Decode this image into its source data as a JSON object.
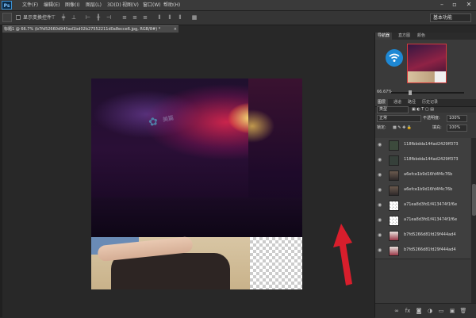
{
  "app": {
    "logo": "Ps"
  },
  "menubar": {
    "items": [
      "文件(F)",
      "编辑(E)",
      "图像(I)",
      "图层(L)",
      "3D(D)",
      "视图(V)",
      "窗口(W)",
      "帮助(H)"
    ]
  },
  "window_controls": {
    "minimize": "–",
    "restore": "▫",
    "close": "✕"
  },
  "options_bar": {
    "show_transform_label": "显示变换控件",
    "workspace": "基本功能"
  },
  "document": {
    "tab_title": "标题1 @ 66.7% (b7fd52660d940ad1bd02b27552211d0a8ecce6.jpg, RGB/8#) *",
    "close": "×",
    "watermark_text": "美篇"
  },
  "navigator": {
    "tabs": [
      "导航器",
      "直方图",
      "颜色"
    ],
    "zoom": "66.67%",
    "zoom_level": 0.25
  },
  "layers_panel": {
    "tabs": [
      "图层",
      "通道",
      "路径",
      "历史记录"
    ],
    "filter_kind": "类型",
    "blend_mode": "正常",
    "opacity_label": "不透明度:",
    "opacity_value": "100%",
    "lock_label": "锁定:",
    "fill_label": "填充:",
    "fill_value": "100%",
    "layers": [
      {
        "name": "118fbbdda144ad2429ff373",
        "thumb": "dark-photo"
      },
      {
        "name": "118fbbdda144ad2429ff373",
        "thumb": "dark-photo"
      },
      {
        "name": "a6efce1b9d16fd4f4c76b",
        "thumb": "person"
      },
      {
        "name": "a6efce1b9d16fd4f4c76b",
        "thumb": "person"
      },
      {
        "name": "a71ea8d3fd1f413474f1f6e",
        "thumb": "transparent"
      },
      {
        "name": "a71ea8d3fd1f413474f1f6e",
        "thumb": "transparent"
      },
      {
        "name": "b7fd5266d81fd29f444ad4",
        "thumb": "person-red"
      },
      {
        "name": "b7fd5266d81fd29f444ad4",
        "thumb": "person-red"
      }
    ],
    "bottom_icons": [
      "link-icon",
      "fx-icon",
      "mask-icon",
      "adjustment-icon",
      "group-icon",
      "new-layer-icon",
      "trash-icon"
    ]
  },
  "colors": {
    "accent": "#d81e2c",
    "selection": "#d23b3b"
  }
}
